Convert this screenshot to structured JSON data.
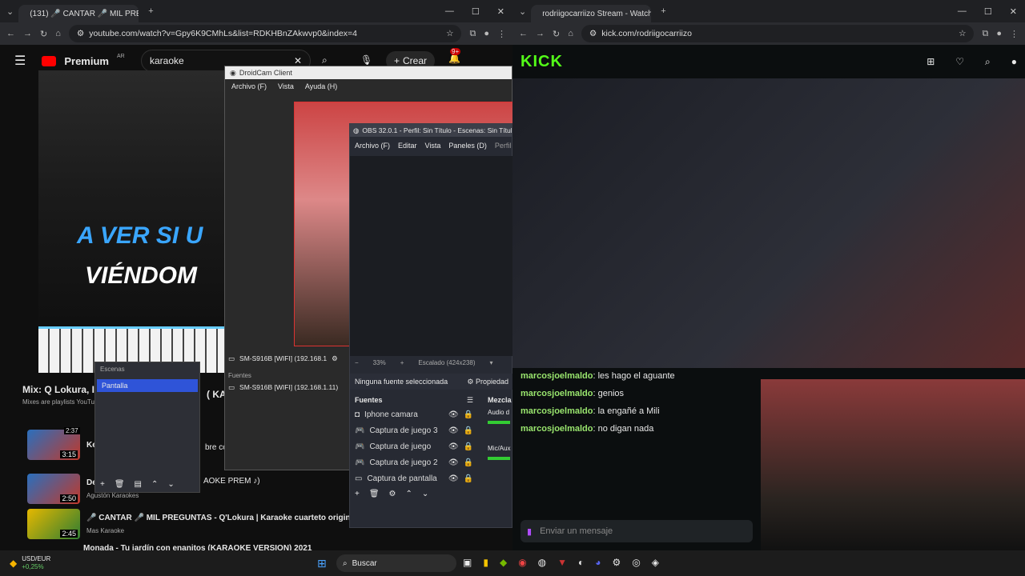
{
  "left_window": {
    "tab_title": "(131) 🎤 CANTAR 🎤 MIL PRE",
    "url": "youtube.com/watch?v=Gpy6K9CMhLs&list=RDKHBnZAkwvp0&index=4",
    "search_value": "karaoke",
    "create_label": "Crear",
    "notif_badge": "9+",
    "brand": "Premium",
    "brand_region": "AR",
    "karaoke_line1": "A VER SI U",
    "karaoke_line2": "VIÉNDOM",
    "mix_title": "Mix: Q Lokura, I",
    "mix_sub": "Mixes are playlists YouTu",
    "playlist_items": [
      {
        "title": "Ke",
        "author": "",
        "duration": "3:15"
      },
      {
        "title": "De",
        "author": "Agustón Karaokes",
        "duration": "2:50"
      },
      {
        "title": "🎤 CANTAR 🎤 MIL PREGUNTAS - Q'Lokura | Karaoke cuarteto original con letra",
        "author": "Mas Karaoke",
        "duration": "2:45"
      },
      {
        "title": "Monada - Tu jardín con enanitos (KARAOKE VERSION) 2021",
        "author": "",
        "duration": ""
      }
    ],
    "partial_text_1": "bre co",
    "partial_text_2": "AOKE PREM ♪)",
    "partial_text_3": "( KA",
    "thumb_top_duration": "2:37"
  },
  "scene_popup": {
    "title": "Escenas",
    "selected": "Pantalla"
  },
  "droidcam": {
    "title": "DroidCam Client",
    "menu": [
      "Archivo (F)",
      "Vista",
      "Ayuda (H)"
    ],
    "device": "SM-S916B [WIFI] (192.168.1",
    "sources_label": "Fuentes",
    "source_item": "SM-S916B [WIFI] (192.168.1.11)"
  },
  "obs": {
    "title": "OBS 32.0.1 - Perfil: Sin Título - Escenas: Sin Título",
    "menu": [
      "Archivo (F)",
      "Editar",
      "Vista",
      "Paneles (D)",
      "Perfil"
    ],
    "zoom": "33%",
    "scale": "Escalado (424x238)",
    "no_source": "Ninguna fuente seleccionada",
    "properties": "Propiedad",
    "sources_title": "Fuentes",
    "mixer_title": "Mezcla",
    "sources": [
      "Iphone camara",
      "Captura de juego 3",
      "Captura de juego",
      "Captura de juego 2",
      "Captura de pantalla"
    ],
    "mixer_items": [
      "Audio d",
      "Mic/Aux"
    ]
  },
  "right_window": {
    "tab_title": "rodriigocarriizo Stream - Watch",
    "url": "kick.com/rodriigocarriizo",
    "logo": "KICK",
    "chat": [
      {
        "user": "marcosjoelmaldo",
        "msg": "les hago el aguante"
      },
      {
        "user": "marcosjoelmaldo",
        "msg": "genios"
      },
      {
        "user": "marcosjoelmaldo",
        "msg": "la engañé a Mili"
      },
      {
        "user": "marcosjoelmaldo",
        "msg": "no digan nada"
      }
    ],
    "chat_placeholder": "Enviar un mensaje"
  },
  "taskbar": {
    "ticker": "USD/EUR",
    "ticker_change": "+0,25%",
    "search": "Buscar"
  },
  "colors": {
    "kick_green": "#53fc18",
    "yt_red": "#ff0000",
    "obs_select": "#2f54d8"
  }
}
